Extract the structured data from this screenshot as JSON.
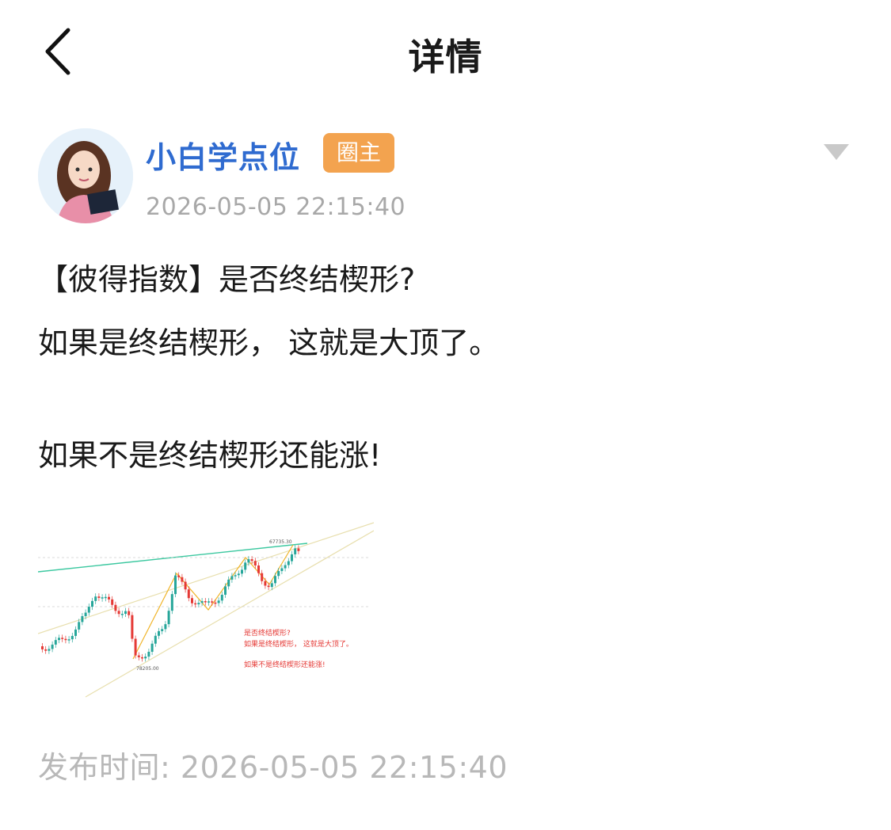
{
  "header": {
    "title": "详情"
  },
  "post": {
    "author": "小白学点位",
    "badge": "圈主",
    "time": "2026-05-05 22:15:40",
    "lines": [
      "【彼得指数】是否终结楔形?",
      "如果是终结楔形， 这就是大顶了。",
      "如果不是终结楔形还能涨!"
    ],
    "image": {
      "price_high": "67735.30",
      "price_low": "78205.00",
      "text_lines": [
        "是否终结楔形?",
        "如果是终结楔形， 这就是大顶了。",
        "如果不是终结楔形还能涨!"
      ]
    },
    "publish_label": "发布时间",
    "publish_sep": ":",
    "publish_time": "2026-05-05 22:15:40"
  },
  "colors": {
    "accent": "#2f6bd0",
    "badge": "#f3a34f",
    "muted": "#a8a8a8",
    "up": "#26a69a",
    "down": "#e53935"
  }
}
